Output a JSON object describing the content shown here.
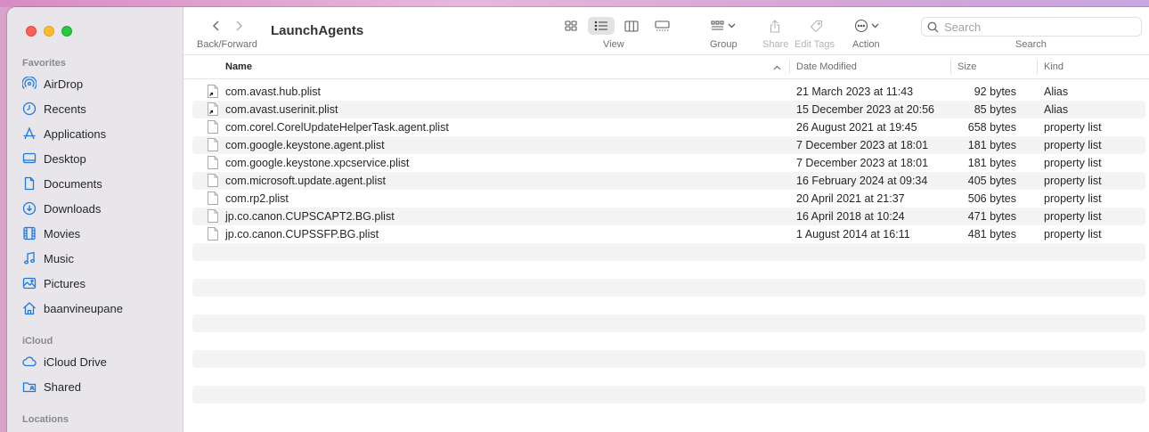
{
  "window": {
    "title": "LaunchAgents"
  },
  "toolbar": {
    "back_forward_label": "Back/Forward",
    "view_label": "View",
    "group_label": "Group",
    "share_label": "Share",
    "edit_tags_label": "Edit Tags",
    "action_label": "Action",
    "search_label": "Search",
    "search_placeholder": "Search"
  },
  "sidebar": {
    "favorites_label": "Favorites",
    "favorites": [
      {
        "label": "AirDrop",
        "icon": "airdrop-icon"
      },
      {
        "label": "Recents",
        "icon": "clock-icon"
      },
      {
        "label": "Applications",
        "icon": "applications-icon"
      },
      {
        "label": "Desktop",
        "icon": "desktop-icon"
      },
      {
        "label": "Documents",
        "icon": "document-icon"
      },
      {
        "label": "Downloads",
        "icon": "download-icon"
      },
      {
        "label": "Movies",
        "icon": "film-icon"
      },
      {
        "label": "Music",
        "icon": "music-note-icon"
      },
      {
        "label": "Pictures",
        "icon": "photo-icon"
      },
      {
        "label": "baanvineupane",
        "icon": "home-icon"
      }
    ],
    "icloud_label": "iCloud",
    "icloud": [
      {
        "label": "iCloud Drive",
        "icon": "cloud-icon"
      },
      {
        "label": "Shared",
        "icon": "shared-folder-icon"
      }
    ],
    "locations_label": "Locations"
  },
  "columns": {
    "name": "Name",
    "date_modified": "Date Modified",
    "size": "Size",
    "kind": "Kind"
  },
  "files": [
    {
      "name": "com.avast.hub.plist",
      "date": "21 March 2023 at 11:43",
      "size": "92 bytes",
      "kind": "Alias",
      "icon": "alias-file-icon"
    },
    {
      "name": "com.avast.userinit.plist",
      "date": "15 December 2023 at 20:56",
      "size": "85 bytes",
      "kind": "Alias",
      "icon": "alias-file-icon"
    },
    {
      "name": "com.corel.CorelUpdateHelperTask.agent.plist",
      "date": "26 August 2021 at 19:45",
      "size": "658 bytes",
      "kind": "property list",
      "icon": "plist-file-icon"
    },
    {
      "name": "com.google.keystone.agent.plist",
      "date": "7 December 2023 at 18:01",
      "size": "181 bytes",
      "kind": "property list",
      "icon": "plist-file-icon"
    },
    {
      "name": "com.google.keystone.xpcservice.plist",
      "date": "7 December 2023 at 18:01",
      "size": "181 bytes",
      "kind": "property list",
      "icon": "plist-file-icon"
    },
    {
      "name": "com.microsoft.update.agent.plist",
      "date": "16 February 2024 at 09:34",
      "size": "405 bytes",
      "kind": "property list",
      "icon": "plist-file-icon"
    },
    {
      "name": "com.rp2.plist",
      "date": "20 April 2021 at 21:37",
      "size": "506 bytes",
      "kind": "property list",
      "icon": "plist-file-icon"
    },
    {
      "name": "jp.co.canon.CUPSCAPT2.BG.plist",
      "date": "16 April 2018 at 10:24",
      "size": "471 bytes",
      "kind": "property list",
      "icon": "plist-file-icon"
    },
    {
      "name": "jp.co.canon.CUPSSFP.BG.plist",
      "date": "1 August 2014 at 16:11",
      "size": "481 bytes",
      "kind": "property list",
      "icon": "plist-file-icon"
    }
  ],
  "colors": {
    "accent": "#1f7ae0",
    "close": "#fe5f57",
    "minimize": "#febc2e",
    "zoom": "#28c840"
  }
}
